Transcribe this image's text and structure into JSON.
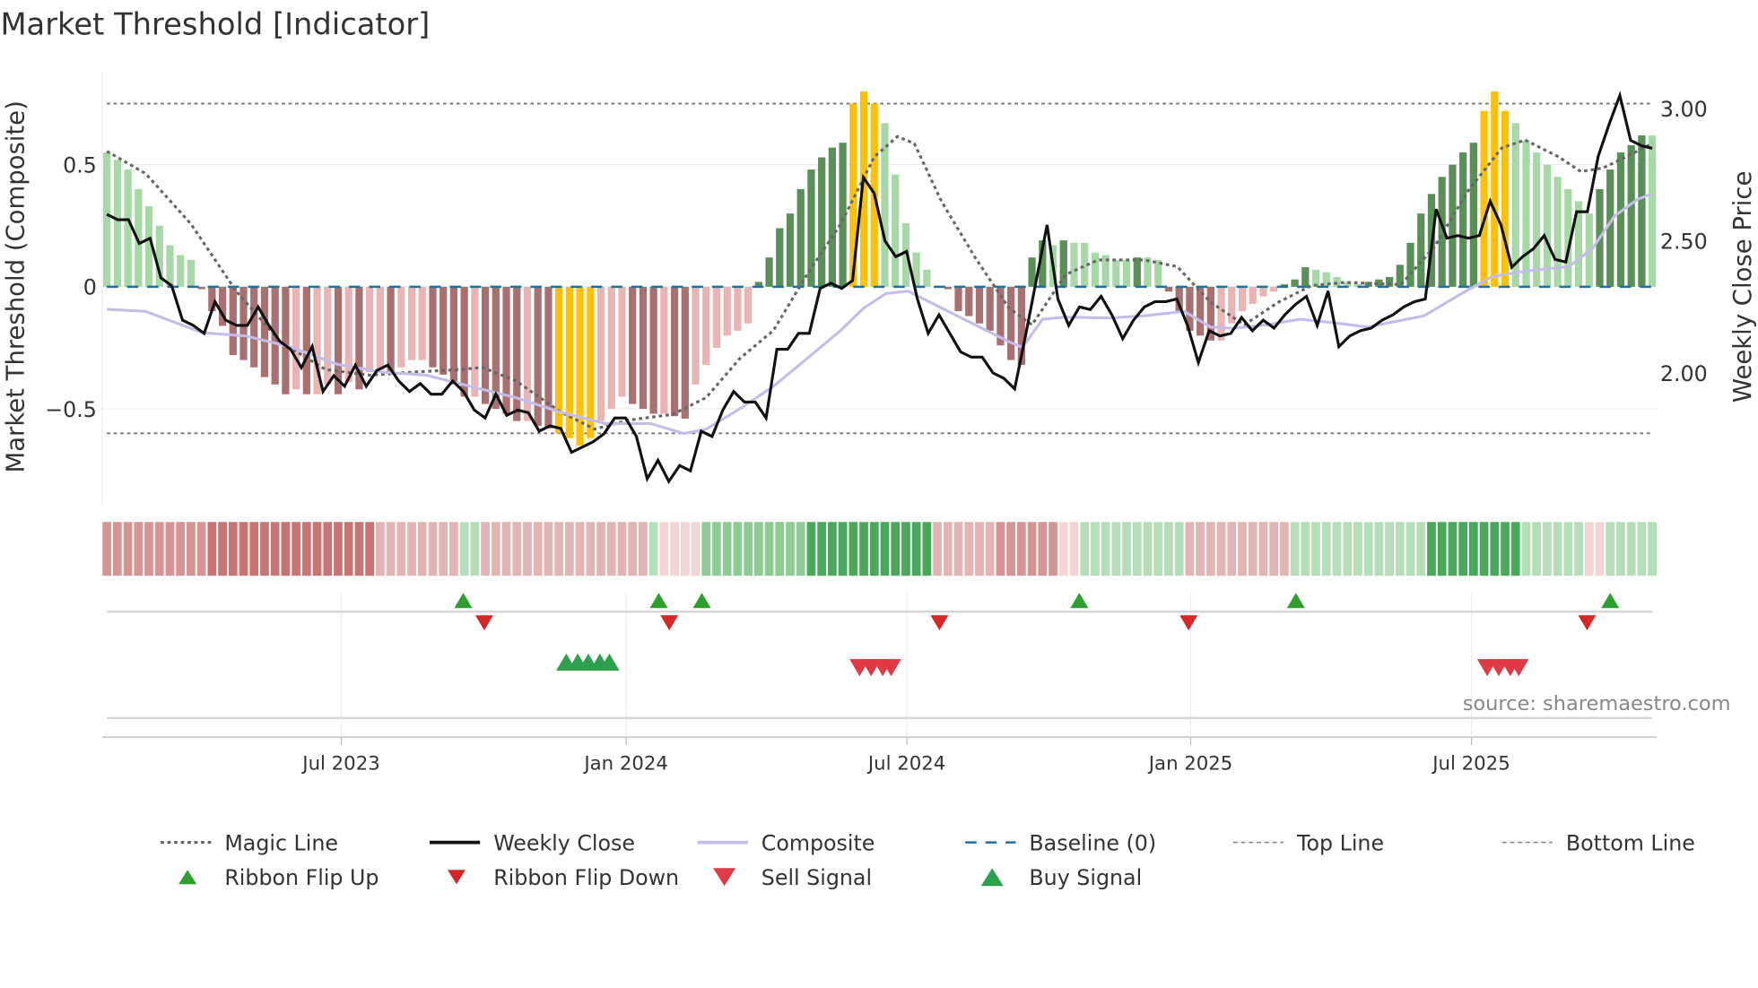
{
  "title": "Market Threshold [Indicator]",
  "source": "source: sharemaestro.com",
  "colors": {
    "dark_green": "#5a8f5a",
    "light_green": "#a8d8a8",
    "dark_red": "#a87070",
    "light_red": "#e8b4b4",
    "extreme": "#ffc107",
    "close": "#111111",
    "composite": "#c4bde8",
    "magic": "#666666",
    "baseline": "#1f6f9f",
    "up": "#2ca02c",
    "down": "#d62728"
  },
  "chart_data": {
    "type": "bar",
    "title": "Market Threshold [Indicator]",
    "ylabel": "Market Threshold (Composite)",
    "y2label": "Weekly Close Price",
    "ylim": [
      -0.85,
      0.85
    ],
    "y2lim": [
      1.5,
      3.1
    ],
    "yticks": [
      {
        "v": 0.5,
        "label": "0.5"
      },
      {
        "v": 0,
        "label": "0"
      },
      {
        "v": -0.5,
        "label": "−0.5"
      }
    ],
    "y2ticks": [
      {
        "v": 3.0,
        "label": "3.00"
      },
      {
        "v": 2.5,
        "label": "2.50"
      },
      {
        "v": 2.0,
        "label": "2.00"
      }
    ],
    "xticks": [
      {
        "w": 22.3,
        "label": "Jul 2023"
      },
      {
        "w": 49.4,
        "label": "Jan 2024"
      },
      {
        "w": 76.1,
        "label": "Jul 2024"
      },
      {
        "w": 103.1,
        "label": "Jan 2025"
      },
      {
        "w": 129.8,
        "label": "Jul 2025"
      }
    ],
    "top_line": 0.75,
    "bottom_line": -0.6,
    "composite_bars": [
      0.55,
      0.52,
      0.48,
      0.4,
      0.33,
      0.25,
      0.17,
      0.13,
      0.11,
      -0.01,
      -0.1,
      -0.16,
      -0.28,
      -0.3,
      -0.33,
      -0.37,
      -0.4,
      -0.44,
      -0.42,
      -0.44,
      -0.44,
      -0.4,
      -0.44,
      -0.39,
      -0.42,
      -0.35,
      -0.34,
      -0.35,
      -0.33,
      -0.3,
      -0.3,
      -0.33,
      -0.36,
      -0.4,
      -0.45,
      -0.45,
      -0.48,
      -0.5,
      -0.52,
      -0.55,
      -0.55,
      -0.57,
      -0.58,
      -0.6,
      -0.62,
      -0.65,
      -0.62,
      -0.55,
      -0.5,
      -0.45,
      -0.48,
      -0.5,
      -0.52,
      -0.52,
      -0.53,
      -0.54,
      -0.4,
      -0.32,
      -0.25,
      -0.2,
      -0.18,
      -0.15,
      0.02,
      0.12,
      0.24,
      0.3,
      0.4,
      0.48,
      0.53,
      0.57,
      0.59,
      0.75,
      0.8,
      0.75,
      0.67,
      0.46,
      0.26,
      0.14,
      0.07,
      0.0,
      -0.01,
      -0.1,
      -0.12,
      -0.15,
      -0.18,
      -0.24,
      -0.3,
      -0.32,
      0.12,
      0.19,
      0.17,
      0.19,
      0.18,
      0.18,
      0.14,
      0.13,
      0.11,
      0.11,
      0.12,
      0.12,
      0.11,
      -0.02,
      -0.1,
      -0.18,
      -0.2,
      -0.22,
      -0.22,
      -0.15,
      -0.1,
      -0.07,
      -0.04,
      -0.02,
      0.01,
      0.03,
      0.08,
      0.07,
      0.06,
      0.04,
      0.02,
      0.01,
      0.02,
      0.03,
      0.04,
      0.09,
      0.18,
      0.3,
      0.38,
      0.45,
      0.5,
      0.55,
      0.59,
      0.72,
      0.8,
      0.72,
      0.67,
      0.6,
      0.55,
      0.5,
      0.45,
      0.4,
      0.35,
      0.3,
      0.4,
      0.48,
      0.55,
      0.58,
      0.62,
      0.62
    ],
    "extreme_bars": [
      43,
      44,
      45,
      46,
      71,
      72,
      73,
      131,
      132,
      133
    ],
    "weekly_close": [
      2.6,
      2.58,
      2.58,
      2.49,
      2.51,
      2.36,
      2.33,
      2.2,
      2.18,
      2.15,
      2.27,
      2.2,
      2.18,
      2.18,
      2.25,
      2.18,
      2.12,
      2.09,
      2.02,
      2.1,
      1.93,
      1.99,
      1.95,
      2.03,
      1.95,
      2.01,
      2.03,
      1.97,
      1.93,
      1.96,
      1.92,
      1.92,
      1.97,
      1.93,
      1.86,
      1.83,
      1.92,
      1.84,
      1.86,
      1.85,
      1.78,
      1.8,
      1.79,
      1.7,
      1.72,
      1.74,
      1.77,
      1.83,
      1.83,
      1.76,
      1.6,
      1.67,
      1.59,
      1.65,
      1.63,
      1.78,
      1.76,
      1.86,
      1.93,
      1.89,
      1.89,
      1.83,
      2.09,
      2.09,
      2.15,
      2.15,
      2.32,
      2.34,
      2.32,
      2.35,
      2.74,
      2.68,
      2.5,
      2.44,
      2.46,
      2.28,
      2.15,
      2.22,
      2.15,
      2.08,
      2.06,
      2.06,
      2.0,
      1.98,
      1.94,
      2.14,
      2.35,
      2.56,
      2.28,
      2.18,
      2.25,
      2.24,
      2.29,
      2.22,
      2.13,
      2.2,
      2.25,
      2.27,
      2.27,
      2.28,
      2.18,
      2.04,
      2.16,
      2.14,
      2.15,
      2.21,
      2.16,
      2.2,
      2.17,
      2.22,
      2.26,
      2.29,
      2.18,
      2.31,
      2.1,
      2.14,
      2.16,
      2.17,
      2.2,
      2.22,
      2.25,
      2.27,
      2.28,
      2.62,
      2.51,
      2.52,
      2.51,
      2.52,
      2.65,
      2.56,
      2.4,
      2.44,
      2.47,
      2.52,
      2.43,
      2.42,
      2.61,
      2.61,
      2.82,
      2.94,
      3.05,
      2.88,
      2.86,
      2.85
    ],
    "magic_line": [
      [
        0,
        0.555
      ],
      [
        3.7,
        0.463
      ],
      [
        8,
        0.257
      ],
      [
        12.3,
        -0.018
      ],
      [
        16.5,
        -0.225
      ],
      [
        20.8,
        -0.339
      ],
      [
        25,
        -0.362
      ],
      [
        29.3,
        -0.349
      ],
      [
        33.6,
        -0.339
      ],
      [
        35.7,
        -0.33
      ],
      [
        38.9,
        -0.385
      ],
      [
        43.2,
        -0.514
      ],
      [
        46.4,
        -0.583
      ],
      [
        49.6,
        -0.546
      ],
      [
        53.8,
        -0.523
      ],
      [
        57,
        -0.454
      ],
      [
        60.2,
        -0.294
      ],
      [
        63.4,
        -0.179
      ],
      [
        66.6,
        0.05
      ],
      [
        69.8,
        0.257
      ],
      [
        73,
        0.532
      ],
      [
        75.2,
        0.615
      ],
      [
        76.8,
        0.587
      ],
      [
        79.4,
        0.349
      ],
      [
        82.6,
        0.119
      ],
      [
        85.8,
        -0.087
      ],
      [
        88,
        -0.156
      ],
      [
        91.2,
        0.05
      ],
      [
        94.3,
        0.11
      ],
      [
        98.6,
        0.11
      ],
      [
        101.8,
        0.083
      ],
      [
        105,
        -0.064
      ],
      [
        108.2,
        -0.156
      ],
      [
        111.4,
        -0.064
      ],
      [
        114.6,
        0.005
      ],
      [
        117.8,
        0.018
      ],
      [
        123.1,
        0.009
      ],
      [
        126.3,
        0.165
      ],
      [
        129.5,
        0.394
      ],
      [
        132.7,
        0.569
      ],
      [
        134.9,
        0.601
      ],
      [
        138.1,
        0.532
      ],
      [
        140.2,
        0.472
      ],
      [
        142.3,
        0.486
      ],
      [
        144.5,
        0.532
      ],
      [
        147,
        0.587
      ]
    ],
    "composite_line": [
      [
        0,
        -0.092
      ],
      [
        3.7,
        -0.101
      ],
      [
        9.1,
        -0.188
      ],
      [
        13.3,
        -0.202
      ],
      [
        17.6,
        -0.248
      ],
      [
        21.9,
        -0.317
      ],
      [
        26.1,
        -0.349
      ],
      [
        30.4,
        -0.362
      ],
      [
        34.6,
        -0.408
      ],
      [
        38.9,
        -0.454
      ],
      [
        43.2,
        -0.514
      ],
      [
        47.4,
        -0.56
      ],
      [
        51.7,
        -0.56
      ],
      [
        54.9,
        -0.601
      ],
      [
        57,
        -0.583
      ],
      [
        60.2,
        -0.5
      ],
      [
        63.4,
        -0.408
      ],
      [
        66.6,
        -0.294
      ],
      [
        69.8,
        -0.179
      ],
      [
        72,
        -0.087
      ],
      [
        74.1,
        -0.028
      ],
      [
        76.2,
        -0.018
      ],
      [
        79.4,
        -0.087
      ],
      [
        82.6,
        -0.156
      ],
      [
        85.8,
        -0.225
      ],
      [
        87.1,
        -0.248
      ],
      [
        89,
        -0.133
      ],
      [
        91.2,
        -0.124
      ],
      [
        95.4,
        -0.128
      ],
      [
        98.6,
        -0.119
      ],
      [
        102.5,
        -0.101
      ],
      [
        105,
        -0.165
      ],
      [
        107.1,
        -0.17
      ],
      [
        110.3,
        -0.156
      ],
      [
        113.5,
        -0.133
      ],
      [
        116.7,
        -0.147
      ],
      [
        119.9,
        -0.165
      ],
      [
        125.3,
        -0.119
      ],
      [
        128.5,
        -0.037
      ],
      [
        131.7,
        0.041
      ],
      [
        134.9,
        0.064
      ],
      [
        139.1,
        0.083
      ],
      [
        141.3,
        0.156
      ],
      [
        143.4,
        0.289
      ],
      [
        145.6,
        0.358
      ],
      [
        147,
        0.381
      ]
    ],
    "ribbon_runs": [
      {
        "from": 0,
        "to": 9,
        "state": "red",
        "strength": 2
      },
      {
        "from": 10,
        "to": 25,
        "state": "red",
        "strength": 3
      },
      {
        "from": 26,
        "to": 33,
        "state": "red",
        "strength": 1
      },
      {
        "from": 34,
        "to": 35,
        "state": "green",
        "strength": 1
      },
      {
        "from": 36,
        "to": 51,
        "state": "red",
        "strength": 1
      },
      {
        "from": 52,
        "to": 52,
        "state": "green",
        "strength": 1
      },
      {
        "from": 53,
        "to": 56,
        "state": "red",
        "strength": 0
      },
      {
        "from": 57,
        "to": 66,
        "state": "green",
        "strength": 2
      },
      {
        "from": 67,
        "to": 78,
        "state": "green",
        "strength": 3
      },
      {
        "from": 79,
        "to": 84,
        "state": "red",
        "strength": 1
      },
      {
        "from": 85,
        "to": 90,
        "state": "red",
        "strength": 2
      },
      {
        "from": 91,
        "to": 92,
        "state": "red",
        "strength": 0
      },
      {
        "from": 93,
        "to": 102,
        "state": "green",
        "strength": 1
      },
      {
        "from": 103,
        "to": 112,
        "state": "red",
        "strength": 1
      },
      {
        "from": 113,
        "to": 125,
        "state": "green",
        "strength": 1
      },
      {
        "from": 126,
        "to": 134,
        "state": "green",
        "strength": 3
      },
      {
        "from": 135,
        "to": 140,
        "state": "green",
        "strength": 1
      },
      {
        "from": 141,
        "to": 142,
        "state": "red",
        "strength": 0
      },
      {
        "from": 143,
        "to": 147,
        "state": "green",
        "strength": 1
      }
    ],
    "ribbon_flip_up": [
      33.9,
      52.5,
      56.6,
      92.5,
      113.1,
      143
    ],
    "ribbon_flip_down": [
      35.9,
      53.5,
      79.2,
      102.9,
      140.8
    ],
    "buy_signals": [
      43.7,
      44.8,
      45.8,
      46.9,
      47.8
    ],
    "sell_signals": [
      71.6,
      72.7,
      73.8,
      74.6,
      131.3,
      132.4,
      133.5,
      134.3
    ]
  },
  "legend": [
    {
      "label": "Magic Line",
      "kind": "dotted",
      "color": "#666666"
    },
    {
      "label": "Weekly Close",
      "kind": "solid",
      "color": "#111111"
    },
    {
      "label": "Composite",
      "kind": "solid",
      "color": "#c4bde8"
    },
    {
      "label": "Baseline (0)",
      "kind": "dashed",
      "color": "#1f6f9f"
    },
    {
      "label": "Top Line",
      "kind": "fine",
      "color": "#888888"
    },
    {
      "label": "Bottom Line",
      "kind": "fine",
      "color": "#888888"
    },
    {
      "label": "Ribbon Flip Up",
      "kind": "up",
      "color": "#2ca02c"
    },
    {
      "label": "Ribbon Flip Down",
      "kind": "down",
      "color": "#d62728"
    },
    {
      "label": "Sell Signal",
      "kind": "downbig",
      "color": "#e03a48"
    },
    {
      "label": "Buy Signal",
      "kind": "upbig",
      "color": "#2ca04c"
    }
  ]
}
